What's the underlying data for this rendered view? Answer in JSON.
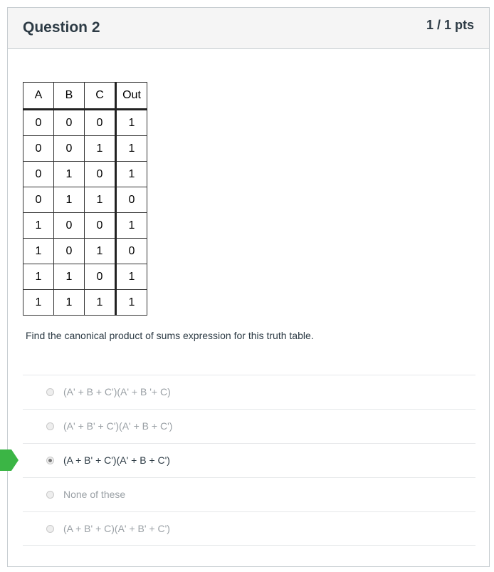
{
  "question": {
    "title": "Question 2",
    "points": "1 / 1 pts",
    "prompt": "Find the canonical product of sums expression for this truth table."
  },
  "truth_table": {
    "headers": [
      "A",
      "B",
      "C",
      "Out"
    ],
    "rows": [
      [
        "0",
        "0",
        "0",
        "1"
      ],
      [
        "0",
        "0",
        "1",
        "1"
      ],
      [
        "0",
        "1",
        "0",
        "1"
      ],
      [
        "0",
        "1",
        "1",
        "0"
      ],
      [
        "1",
        "0",
        "0",
        "1"
      ],
      [
        "1",
        "0",
        "1",
        "0"
      ],
      [
        "1",
        "1",
        "0",
        "1"
      ],
      [
        "1",
        "1",
        "1",
        "1"
      ]
    ]
  },
  "answers": [
    {
      "label": "(A' + B + C')(A' + B '+ C)",
      "selected": false
    },
    {
      "label": "(A' + B' + C')(A' + B + C')",
      "selected": false
    },
    {
      "label": "(A + B' + C')(A' + B + C')",
      "selected": true
    },
    {
      "label": "None of these",
      "selected": false
    },
    {
      "label": "(A + B' + C)(A' + B' + C')",
      "selected": false
    }
  ],
  "colors": {
    "correct_flag": "#3bb545",
    "header_bg": "#f5f5f5",
    "text": "#2d3b45",
    "unselected_text": "#9aa0a5"
  },
  "icons": {
    "correct_indicator": "correct-answer-flag-icon"
  }
}
